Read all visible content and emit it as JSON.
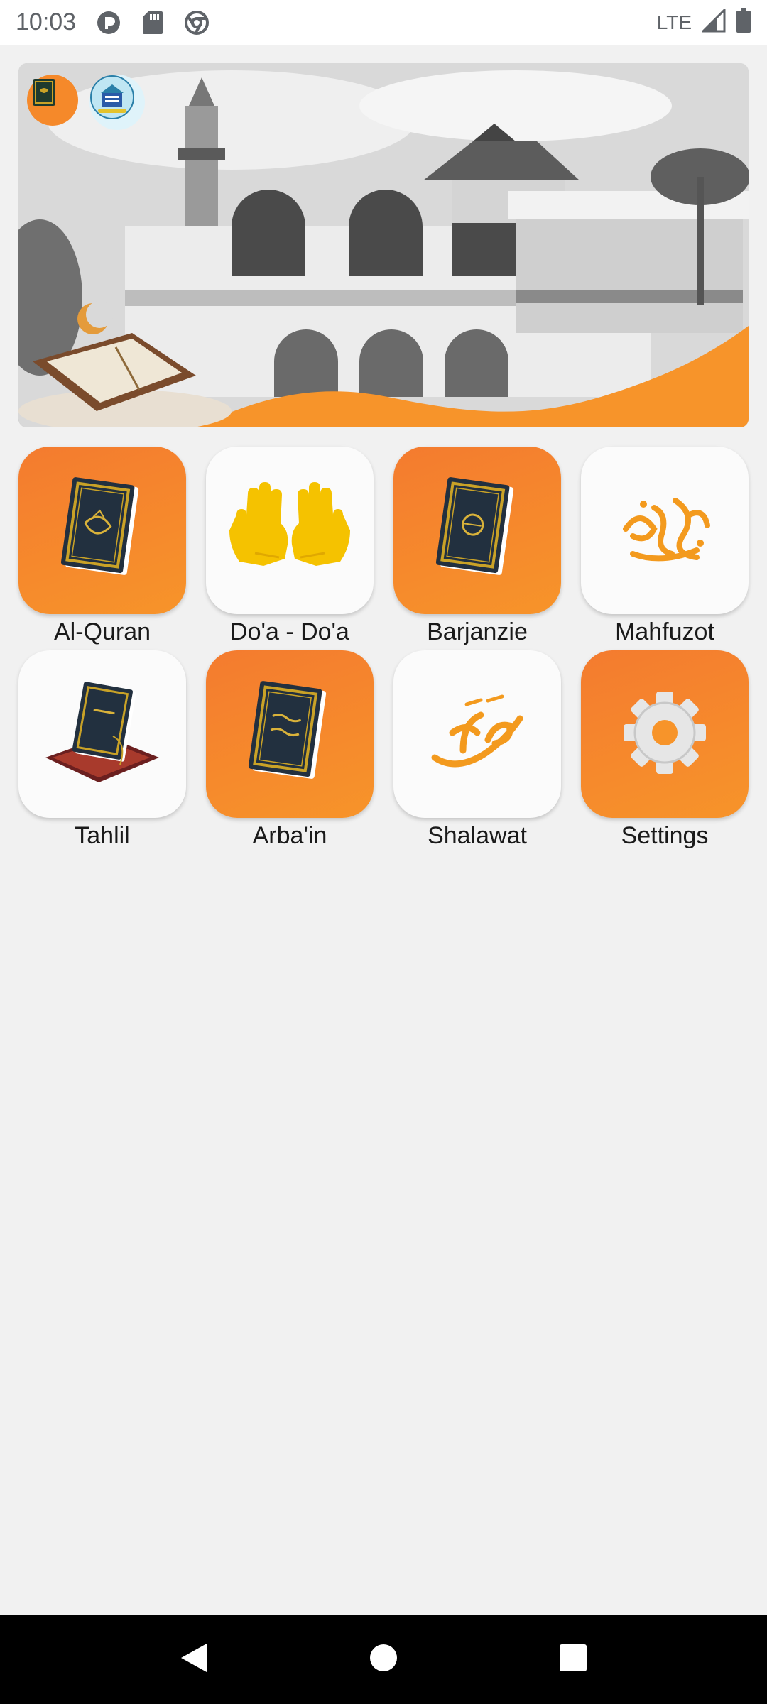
{
  "status_bar": {
    "time": "10:03",
    "network": "LTE",
    "icons": [
      "pocket-icon",
      "sd-card-icon",
      "chrome-icon"
    ]
  },
  "banner": {
    "image": "mosque-photo",
    "logos": [
      "quran-app-logo",
      "school-logo"
    ],
    "accent_color": "#f7942a"
  },
  "menu": {
    "items": [
      {
        "label": "Al-Quran",
        "icon": "quran-book-icon",
        "style": "orange"
      },
      {
        "label": "Do'a - Do'a",
        "icon": "praying-hands-icon",
        "style": "white"
      },
      {
        "label": "Barjanzie",
        "icon": "book-icon",
        "style": "orange"
      },
      {
        "label": "Mahfuzot",
        "icon": "arabic-calligraphy-icon",
        "style": "white"
      },
      {
        "label": "Tahlil",
        "icon": "book-on-mat-icon",
        "style": "white"
      },
      {
        "label": "Arba'in",
        "icon": "arbain-book-icon",
        "style": "orange"
      },
      {
        "label": "Shalawat",
        "icon": "muhammad-calligraphy-icon",
        "style": "white"
      },
      {
        "label": "Settings",
        "icon": "gear-icon",
        "style": "orange"
      }
    ]
  },
  "colors": {
    "orange": "#f47b2f",
    "orange_light": "#f7942a",
    "background": "#f1f1f1"
  },
  "nav_bar": {
    "buttons": [
      "back-icon",
      "home-icon",
      "recents-icon"
    ]
  }
}
